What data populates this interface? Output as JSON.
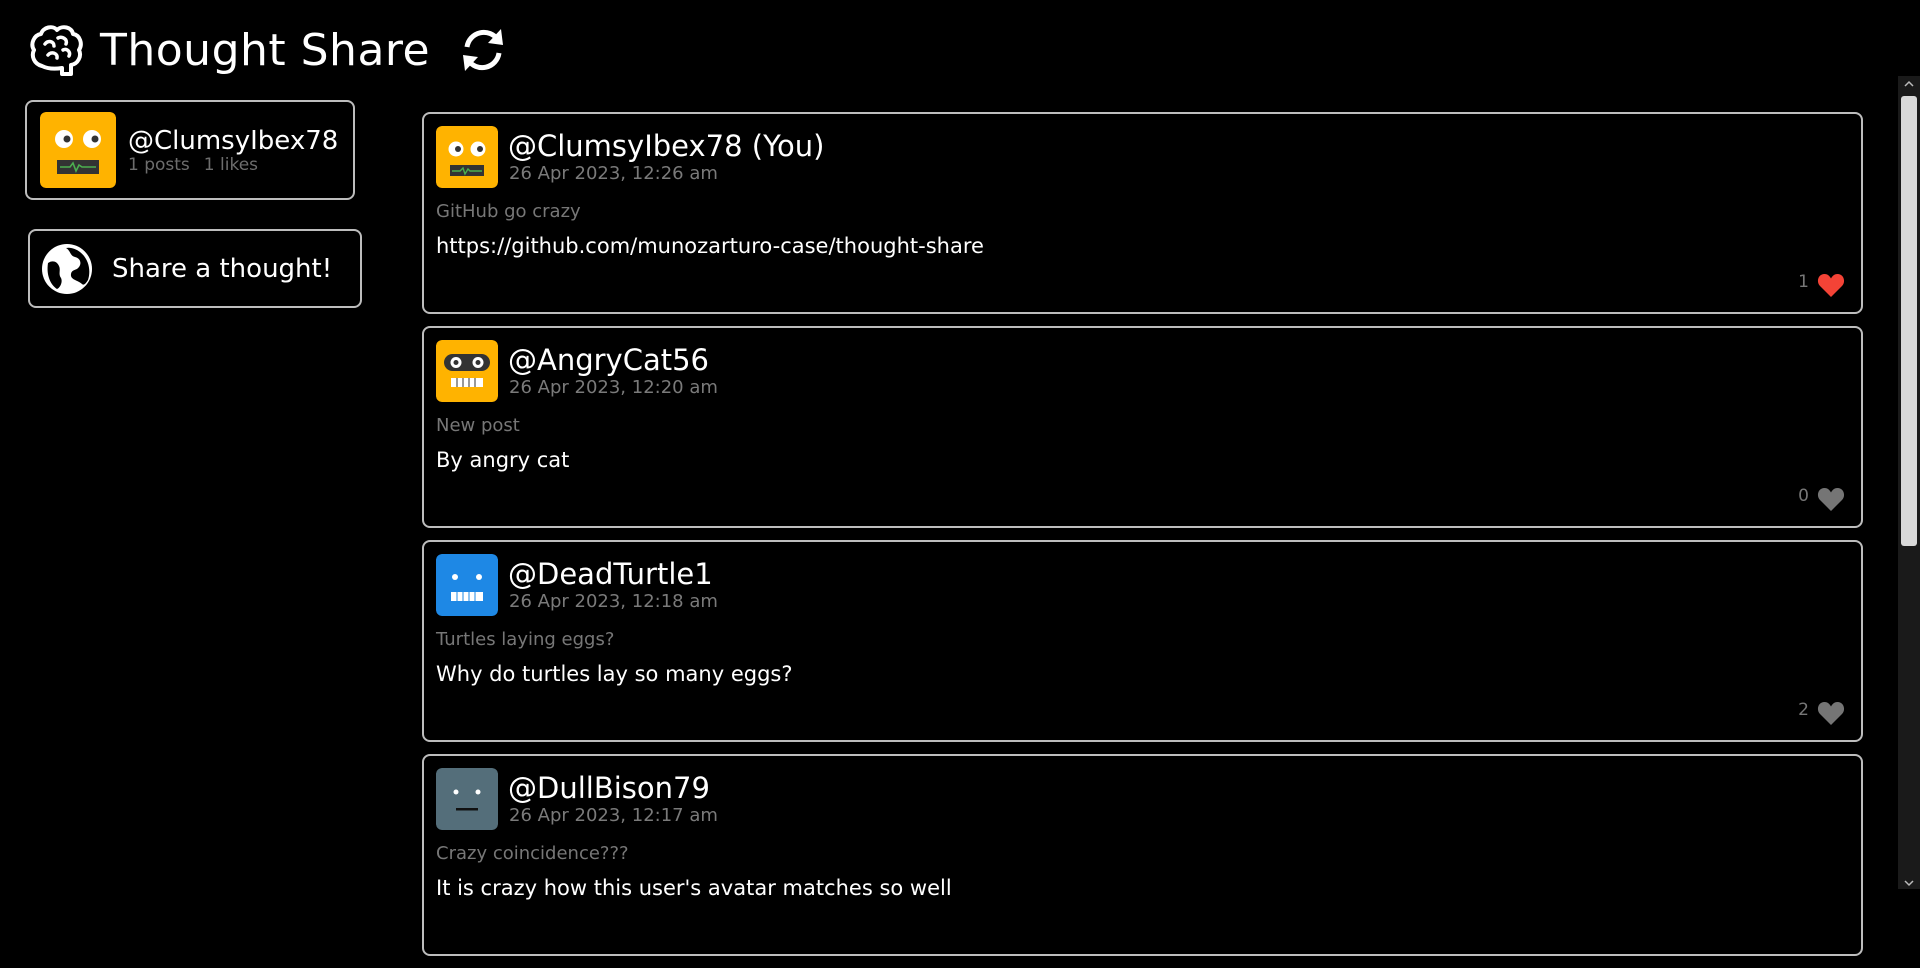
{
  "header": {
    "title": "Thought Share"
  },
  "profile": {
    "username": "@ClumsyIbex78",
    "posts": "1 posts",
    "likes": "1 likes",
    "avatar_color": "#ffb300"
  },
  "share_button": {
    "label": "Share a thought!"
  },
  "posts": [
    {
      "user": "@ClumsyIbex78 (You)",
      "date": "26 Apr 2023, 12:26 am",
      "title": "GitHub go crazy",
      "body": "https://github.com/munozarturo-case/thought-share",
      "likes": "1",
      "liked": true,
      "avatar_color": "#ffb300"
    },
    {
      "user": "@AngryCat56",
      "date": "26 Apr 2023, 12:20 am",
      "title": "New post",
      "body": "By angry cat",
      "likes": "0",
      "liked": false,
      "avatar_color": "#ffb300"
    },
    {
      "user": "@DeadTurtle1",
      "date": "26 Apr 2023, 12:18 am",
      "title": "Turtles laying eggs?",
      "body": "Why do turtles lay so many eggs?",
      "likes": "2",
      "liked": false,
      "avatar_color": "#1e88e5"
    },
    {
      "user": "@DullBison79",
      "date": "26 Apr 2023, 12:17 am",
      "title": "Crazy coincidence???",
      "body": "It is crazy how this user's avatar matches so well",
      "likes": "",
      "liked": false,
      "avatar_color": "#546e7a"
    }
  ],
  "colors": {
    "liked_heart": "#f44336",
    "unliked_heart": "#757575",
    "border": "#bdbdbd"
  }
}
